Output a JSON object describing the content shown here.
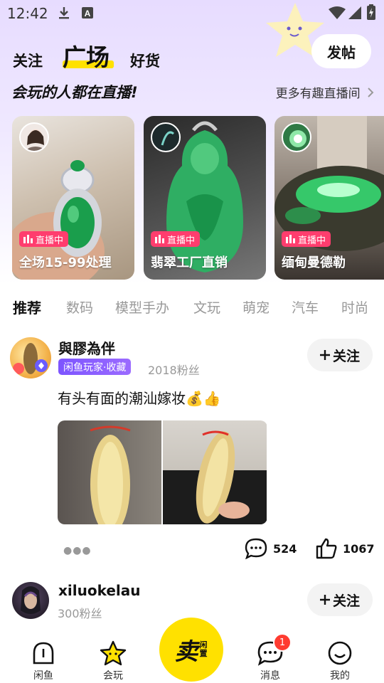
{
  "status_bar": {
    "time": "12:42",
    "icons": [
      "download-icon",
      "font-a-icon",
      "wifi-icon",
      "signal-icon",
      "battery-icon"
    ]
  },
  "top_tabs": {
    "follow": "关注",
    "plaza": "广场",
    "goods": "好货",
    "active": "广场"
  },
  "post_button": "发帖",
  "live_section": {
    "title": "会玩的人都在直播!",
    "more": "更多有趣直播间",
    "badge_label": "直播中",
    "cards": [
      {
        "caption": "全场15-99处理"
      },
      {
        "caption": "翡翠工厂直销"
      },
      {
        "caption": "缅甸曼德勒"
      }
    ]
  },
  "category_tabs": [
    "推荐",
    "数码",
    "模型手办",
    "文玩",
    "萌宠",
    "汽车",
    "时尚"
  ],
  "active_category": "推荐",
  "posts": [
    {
      "user": "與膠為伴",
      "tag": "闲鱼玩家·收藏",
      "fans": "2018粉丝",
      "follow_label": "关注",
      "text": "有头有面的潮汕嫁妆💰👍",
      "comments": "524",
      "likes": "1067"
    },
    {
      "user": "xiluokelau",
      "fans": "300粉丝",
      "follow_label": "关注"
    }
  ],
  "bottom_nav": {
    "items": [
      {
        "label": "闲鱼",
        "icon": "xianyu-home-icon"
      },
      {
        "label": "会玩",
        "icon": "star-icon"
      },
      {
        "label": "消息",
        "icon": "message-icon",
        "badge": "1"
      },
      {
        "label": "我的",
        "icon": "smile-face-icon"
      }
    ],
    "sell_main": "卖",
    "sell_sub": "闲置"
  },
  "colors": {
    "accent_yellow": "#ffe100",
    "live_badge": "#ff3d6e",
    "tag_purple": "#8a5cff",
    "header_bg": "#e7dcff",
    "badge_red": "#ff3b30"
  }
}
